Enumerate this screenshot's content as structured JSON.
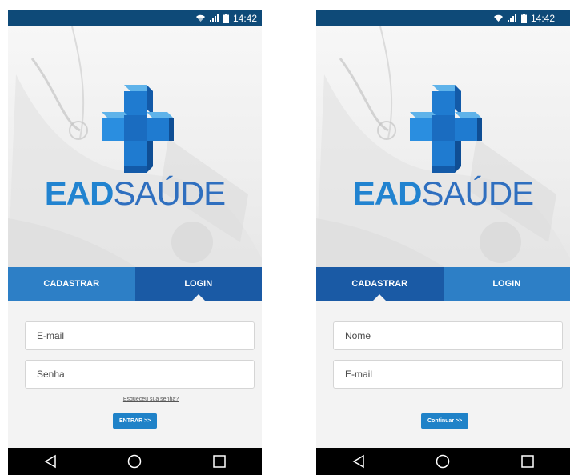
{
  "status": {
    "time": "14:42",
    "time_right": "14:42"
  },
  "brand": {
    "part1": "EAD",
    "part2": "SAÚDE"
  },
  "tabs": {
    "register": "CADASTRAR",
    "login": "LOGIN"
  },
  "login_screen": {
    "email_placeholder": "E-mail",
    "password_placeholder": "Senha",
    "forgot_link": "Esqueceu sua senha?",
    "submit_label": "ENTRAR >>"
  },
  "register_screen": {
    "name_placeholder": "Nome",
    "email_placeholder": "E-mail",
    "continue_label": "Continuar >>"
  },
  "colors": {
    "status_bar": "#0e4a78",
    "tab_light": "#2d7fc6",
    "tab_dark": "#1a5aa5",
    "button": "#1f82c8"
  },
  "icons": [
    "wifi-icon",
    "signal-icon",
    "battery-icon",
    "back-icon",
    "home-icon",
    "recents-icon",
    "medical-cross-icon"
  ]
}
